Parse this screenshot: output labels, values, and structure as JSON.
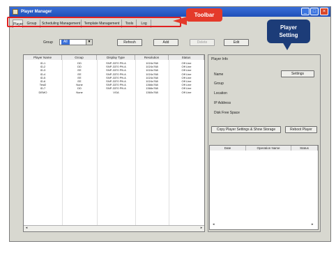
{
  "window": {
    "title": "Player Manager"
  },
  "tabs": [
    "Player",
    "Group",
    "Scheduling Management",
    "Template Management",
    "Tools",
    "Log"
  ],
  "callouts": {
    "toolbar": "Toolbar",
    "player_setting_1": "Player",
    "player_setting_2": "Setting"
  },
  "controls": {
    "group_label": "Group",
    "group_value": "All",
    "refresh": "Refresh",
    "add": "Add",
    "delete": "Delete",
    "edit": "Edit"
  },
  "player_table": {
    "headers": [
      "Player Name",
      "Group",
      "Display Type",
      "Resolution",
      "Status"
    ],
    "rows": [
      [
        "ID-1",
        "DD",
        "SNP-3370 PN A",
        "1024x768",
        "Off Line"
      ],
      [
        "ID-2",
        "DD",
        "SNP-3370 PN A",
        "1024x768",
        "Off Line"
      ],
      [
        "ID-3",
        "EE",
        "SNP-3370 PN A",
        "1024x768",
        "Off Line"
      ],
      [
        "ID-4",
        "EE",
        "SNP-3370 PN A",
        "1024x768",
        "Off Line"
      ],
      [
        "ID-5",
        "EE",
        "SNP-3370 PN A",
        "1024x768",
        "Off Line"
      ],
      [
        "ID-6",
        "EE",
        "SNP-3370 PN A",
        "1024x768",
        "Off Line"
      ],
      [
        "Test2",
        "None",
        "SNP-3370 PN A",
        "1366x768",
        "Off Line"
      ],
      [
        "ID-7",
        "DD",
        "SNP-3370 PN A",
        "1366x768",
        "Off Line"
      ],
      [
        "DEMO",
        "None",
        "VGA",
        "1360x768",
        "Off Line"
      ]
    ]
  },
  "player_info": {
    "heading": "Player Info",
    "fields": [
      "Name",
      "Group",
      "Location",
      "IP Address",
      "Disk Free Space"
    ],
    "settings_btn": "Settings",
    "copy_btn": "Copy Player Settings & Show Storage",
    "reboot_btn": "Reboot Player",
    "sub_headers": [
      "Date",
      "Operation Name",
      "Status"
    ]
  },
  "colors": {
    "accent": "#1f4fb8",
    "toolbar_callout": "#e43a2a",
    "setting_callout": "#1c3c78"
  }
}
